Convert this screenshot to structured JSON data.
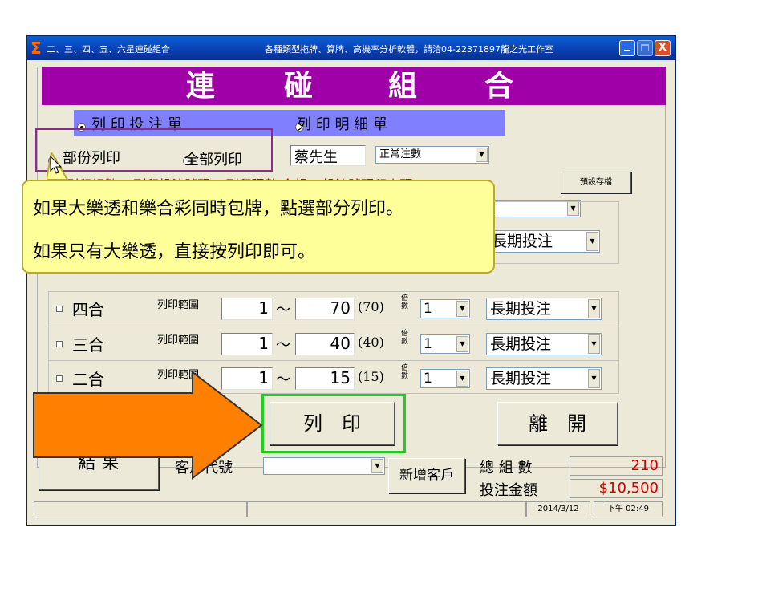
{
  "window": {
    "title": "二、三、四、五、六星連碰組合",
    "subtitle": "各種類型拖牌、算牌、高機率分析軟體，請洽04-22371897龍之光工作室",
    "min": "_",
    "max": "□",
    "close": "X"
  },
  "banner": {
    "chars": [
      "連",
      "碰",
      "組",
      "合"
    ]
  },
  "print_mode": {
    "option1": "列 印 投 注 單",
    "option2": "列 印 明 細 單"
  },
  "print_range": {
    "partial": "部份列印",
    "all": "全部列印"
  },
  "customer_name": "蔡先生",
  "bet_type": "正常注數",
  "partial_row": "列印組數□ 列印投注號碼☑ 列印張數  金額☐ 投注號碼印表頭",
  "save_default": "預設存檔",
  "top_long_term": "長期投注",
  "rows": [
    {
      "label": "四合",
      "range_label": "列印範圍",
      "from": "1",
      "tilde": "～",
      "to": "70",
      "total": "(70)",
      "mult_label": "倍數",
      "mult": "1",
      "mode": "長期投注"
    },
    {
      "label": "三合",
      "range_label": "列印範圍",
      "from": "1",
      "tilde": "～",
      "to": "40",
      "total": "(40)",
      "mult_label": "倍數",
      "mult": "1",
      "mode": "長期投注"
    },
    {
      "label": "二合",
      "range_label": "列印範圍",
      "from": "1",
      "tilde": "～",
      "to": "15",
      "total": "(15)",
      "mult_label": "倍數",
      "mult": "1",
      "mode": "長期投注"
    }
  ],
  "print_button": "列　印",
  "exit_button": "離　開",
  "result_button": "結 果",
  "customer_code_label": "客戶代號",
  "new_customer": "新增客戶",
  "total_groups_label": "總 組 數",
  "total_groups": "210",
  "bet_amount_label": "投注金額",
  "bet_amount": "$10,500",
  "date": "2014/3/12",
  "time": "下午 02:49",
  "callout": {
    "line1": "如果大樂透和樂合彩同時包牌，點選部分列印。",
    "line2": "如果只有大樂透，直接按列印即可。"
  },
  "colors": {
    "banner": "#a000a8",
    "highlight_green": "#22cc22",
    "highlight_purple": "#8a2d8a",
    "arrow": "#ff8000",
    "amount_red": "#cc0000"
  }
}
